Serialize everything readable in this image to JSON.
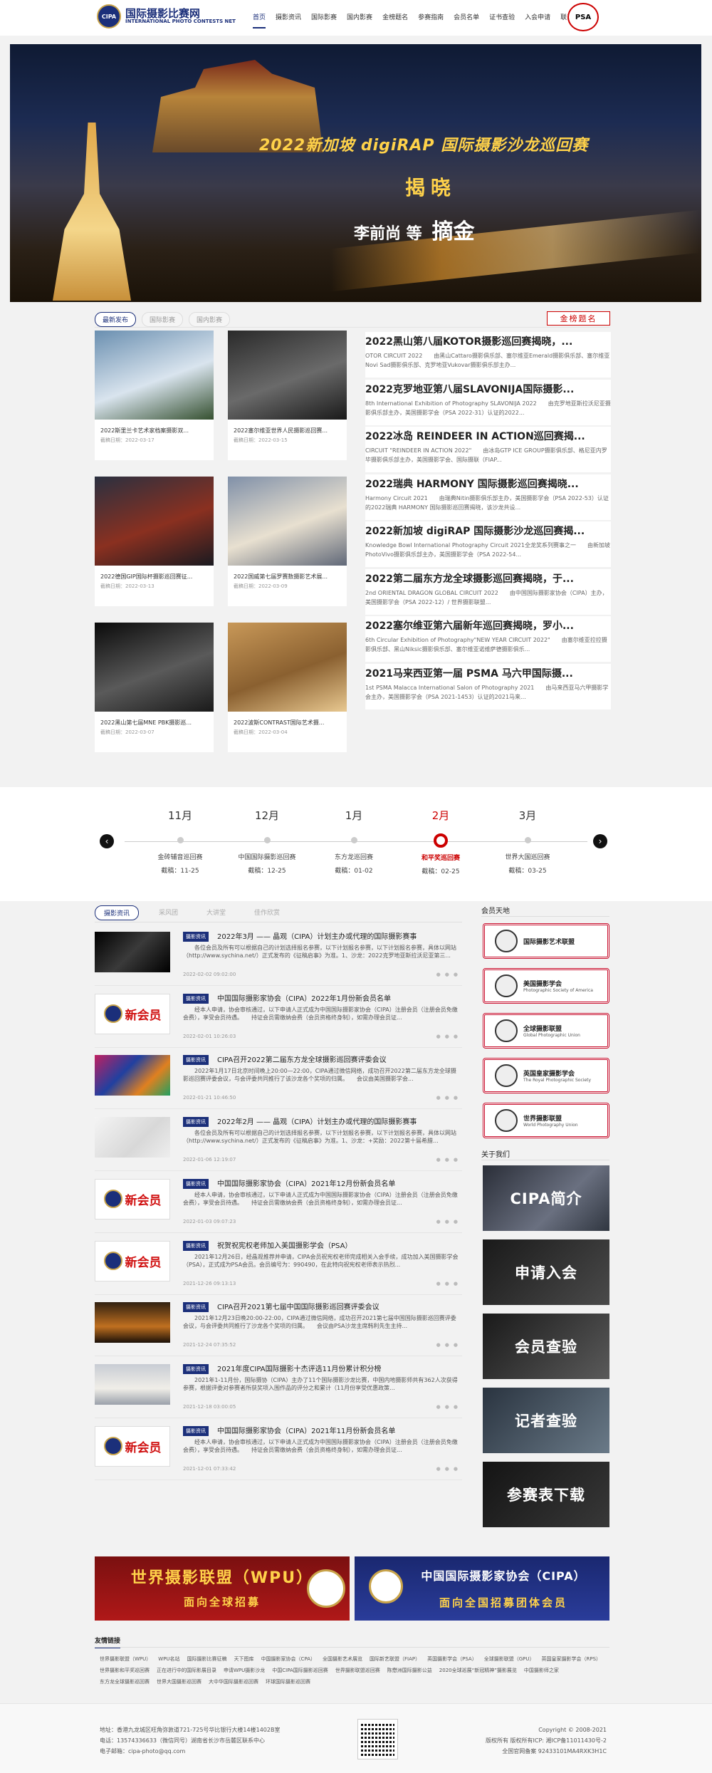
{
  "header": {
    "logo_cn": "国际摄影比赛网",
    "logo_en": "INTERNATIONAL PHOTO CONTESTS NET",
    "logo_badge": "CIPA",
    "nav": [
      "首页",
      "摄影资讯",
      "国际影赛",
      "国内影赛",
      "金榜题名",
      "参赛指南",
      "会员名单",
      "证书查验",
      "入会申请",
      "联系我们"
    ],
    "psa_badge": "PSA"
  },
  "banner": {
    "title": "2022新加坡 digiRAP 国际摄影沙龙巡回赛",
    "reveal": "揭晓",
    "name": "李前尚 等",
    "award": "摘金"
  },
  "news_tabs": [
    "最新发布",
    "国际影赛",
    "国内影赛"
  ],
  "gold_button": "金榜题名",
  "photo_cards": [
    {
      "title": "2022斯里兰卡艺术家档案摄影双...",
      "date": "截稿日期：2022-03-17",
      "palette": [
        "#6a8fb0",
        "#d9e4ee",
        "#355030"
      ]
    },
    {
      "title": "2022塞尔维亚世界人民摄影巡回赛...",
      "date": "截稿日期：2022-03-15",
      "palette": [
        "#2a2a2a",
        "#6a6a6a",
        "#1a1a1a"
      ]
    },
    {
      "title": "2022德国GIP国际杯摄影巡回赛征...",
      "date": "截稿日期：2022-03-13",
      "palette": [
        "#2a3040",
        "#8a3020",
        "#1a1a20"
      ]
    },
    {
      "title": "2022国威第七届罗赛数摄影艺术展...",
      "date": "截稿日期：2022-03-09",
      "palette": [
        "#8090a8",
        "#e8e0d0",
        "#606878"
      ]
    },
    {
      "title": "2022黑山第七届MNE PBK摄影巡...",
      "date": "截稿日期：2022-03-07",
      "palette": [
        "#0a0a0a",
        "#5a5a5a",
        "#1a1a1a"
      ]
    },
    {
      "title": "2022波斯CONTRAST国际艺术摄...",
      "date": "截稿日期：2022-03-04",
      "palette": [
        "#c89858",
        "#8a6030",
        "#e8c890"
      ]
    }
  ],
  "news_list": [
    {
      "title": "2022黑山第八届KOTOR摄影巡回赛揭晓，...",
      "desc": "OTOR CIRCUIT 2022　　由黑山Cattaro摄影俱乐部、塞尔维亚Emerald摄影俱乐部、塞尔维亚Novi Sad摄影俱乐部、克罗地亚Vukovar摄影俱乐部主办..."
    },
    {
      "title": "2022克罗地亚第八届SLAVONIJA国际摄影...",
      "desc": "8th International Exhibition of Photography SLAVONIJA 2022　　由克罗地亚斯拉沃尼亚摄影俱乐部主办，美国摄影学会（PSA 2022-31）认证的2022..."
    },
    {
      "title": "2022冰岛 REINDEER IN ACTION巡回赛揭...",
      "desc": "CIRCUIT \"REINDEER IN ACTION 2022\"　　由冰岛GTP ICE GROUP摄影俱乐部、格尼亚内罗毕摄影俱乐部主办，美国摄影学会、国际摄联（FIAP..."
    },
    {
      "title": "2022瑞典 HARMONY 国际摄影巡回赛揭晓...",
      "desc": "Harmony Circuit 2021　　由瑞典Nitin摄影俱乐部主办，美国摄影学会（PSA 2022-53）认证的2022瑞典 HARMONY 国际摄影巡回赛揭晓，该沙龙共设..."
    },
    {
      "title": "2022新加坡 digiRAP 国际摄影沙龙巡回赛揭...",
      "desc": "Knowledge Bowl International Photography Circuit 2021全龙奖系列赛事之一　　由新加坡PhotoVivo摄影俱乐部主办，美国摄影学会（PSA 2022-54..."
    },
    {
      "title": "2022第二届东方龙全球摄影巡回赛揭晓，于...",
      "desc": "2nd ORIENTAL DRAGON GLOBAL CIRCUIT 2022　　由中国国际摄影家协会（CIPA）主办，美国摄影学会（PSA 2022-12）/ 世界摄影联盟..."
    },
    {
      "title": "2022塞尔维亚第六届新年巡回赛揭晓，罗小...",
      "desc": "6th Circular Exhibition of Photography\"NEW YEAR CIRCUIT 2022\"　　由塞尔维亚拉拉摄影俱乐部、黑山Niksic摄影俱乐部、塞尔维亚诺维萨德摄影俱乐..."
    },
    {
      "title": "2021马来西亚第一届 PSMA 马六甲国际摄...",
      "desc": "1st PSMA Malacca International Salon of Photography 2021　　由马来西亚马六甲摄影学会主办，美国摄影学会（PSA 2021-1453）认证的2021马来..."
    }
  ],
  "timeline": {
    "items": [
      {
        "month": "11月",
        "name": "金砖辅音巡回赛",
        "date": "截稿：11-25"
      },
      {
        "month": "12月",
        "name": "中国国际摄影巡回赛",
        "date": "截稿：12-25"
      },
      {
        "month": "1月",
        "name": "东方龙巡回赛",
        "date": "截稿：01-02"
      },
      {
        "month": "2月",
        "name": "和平奖巡回赛",
        "date": "截稿：02-25"
      },
      {
        "month": "3月",
        "name": "世界大国巡回赛",
        "date": "截稿：03-25"
      }
    ]
  },
  "article_tabs": [
    "摄影资讯",
    "采风团",
    "大讲堂",
    "佳作欣赏"
  ],
  "articles": [
    {
      "tag": "摄影资讯",
      "title": "2022年3月 —— 晶观（CIPA）计划主办或代理的国际摄影赛事",
      "desc": "各位会员及所有可以根据自己的计划选择报名参赛，以下计划报名参赛，以下计划报名参赛，具体以网站（http://www.sychina.net/）正式发布的《征稿启事》为准。1、沙龙：2022克罗地亚斯拉沃尼亚第三...",
      "date": "2022-02-02 09:02:00",
      "thumb": "dark"
    },
    {
      "tag": "摄影资讯",
      "title": "中国国际摄影家协会（CIPA）2022年1月份新会员名单",
      "desc": "经本人申请，协会审核通过，以下申请人正式成为中国国际摄影家协会（CIPA）注册会员（注册会员免缴会费），享受会员待遇。　　持证会员需缴纳会费（会员资格终身制），如需办理会员证...",
      "date": "2022-02-01 10:26:03",
      "thumb": "member"
    },
    {
      "tag": "摄影资讯",
      "title": "CIPA召开2022第二届东方龙全球摄影巡回赛评委会议",
      "desc": "2022年1月17日北京时间晚上20:00—22:00，CIPA通过微信网络，成功召开2022第二届东方龙全球摄影巡回赛评委会议，与会评委共同推行了该沙龙各个奖项的归属。　　会议由美国摄影学会...",
      "date": "2022-01-21 10:46:50",
      "thumb": "color"
    },
    {
      "tag": "摄影资讯",
      "title": "2022年2月 —— 晶观（CIPA）计划主办或代理的国际摄影赛事",
      "desc": "各位会员及所有可以根据自己的计划选择报名参赛，以下计划报名参赛，以下计划报名参赛，具体以网站（http://www.sychina.net/）正式发布的《征稿启事》为准。1、沙龙：+奖励：2022第十届希腊...",
      "date": "2022-01-06 12:19:07",
      "thumb": "white"
    },
    {
      "tag": "摄影资讯",
      "title": "中国国际摄影家协会（CIPA）2021年12月份新会员名单",
      "desc": "经本人申请，协会审核通过，以下申请人正式成为中国国际摄影家协会（CIPA）注册会员（注册会员免缴会费），享受会员待遇。　　持证会员需缴纳会费（会员资格终身制），如需办理会员证...",
      "date": "2022-01-03 09:07:23",
      "thumb": "member"
    },
    {
      "tag": "摄影资讯",
      "title": "祝贺祝宪权老师加入美国摄影学会（PSA）",
      "desc": "2021年12月26日，经晶观推荐并申请，CIPA会员祝宪权老师完成相关入会手续，成功加入美国摄影学会（PSA），正式成为PSA会员。会员编号为：990490，在此特向祝宪权老师表示热烈...",
      "date": "2021-12-26 09:13:13",
      "thumb": "member"
    },
    {
      "tag": "摄影资讯",
      "title": "CIPA召开2021第七届中国国际摄影巡回赛评委会议",
      "desc": "2021年12月23日晚20:00-22:00，CIPA通过微信网络，成功召开2021第七届中国国际摄影巡回赛评委会议，与会评委共同推行了沙龙各个奖项的归属。　　会议由PSA沙龙主席韩利先生主持...",
      "date": "2021-12-24 07:35:52",
      "thumb": "orange"
    },
    {
      "tag": "摄影资讯",
      "title": "2021年度CIPA国际摄影十杰评选11月份累计积分榜",
      "desc": "2021年1-11月份，国际摄协（CIPA）主办了11个国际摄影沙龙比赛，中国内地摄影师共有362人次获得参赛，根据评委对参赛者所获奖项入围作品的评分之和累计（11月份享受优惠政策...",
      "date": "2021-12-18 03:00:05",
      "thumb": "mosque"
    },
    {
      "tag": "摄影资讯",
      "title": "中国国际摄影家协会（CIPA）2021年11月份新会员名单",
      "desc": "经本人申请，协会审核通过，以下申请人正式成为中国国际摄影家协会（CIPA）注册会员（注册会员免缴会费），享受会员待遇。　　持证会员需缴纳会费（会员资格终身制），如需办理会员证...",
      "date": "2021-12-01 07:33:42",
      "thumb": "member"
    }
  ],
  "new_member_label": "新会员",
  "sidebar": {
    "members_heading": "会员天地",
    "members": [
      {
        "cn": "国际摄影艺术联盟",
        "en": ""
      },
      {
        "cn": "美国摄影学会",
        "en": "Photographic Society of America"
      },
      {
        "cn": "全球摄影联盟",
        "en": "Global Photographic Union"
      },
      {
        "cn": "英国皇家摄影学会",
        "en": "The Royal Photographic Society"
      },
      {
        "cn": "世界摄影联盟",
        "en": "World Photography Union"
      }
    ],
    "about_heading": "关于我们",
    "about": [
      "CIPA简介",
      "申请入会",
      "会员查验",
      "记者查验",
      "参赛表下载"
    ]
  },
  "promos": [
    {
      "title": "世界摄影联盟（WPU）",
      "sub": "面向全球招募"
    },
    {
      "title": "中国国际摄影家协会（CIPA）",
      "sub": "面向全国招募团体会员"
    }
  ],
  "links": {
    "heading": "友情链接",
    "items": [
      "世界摄影联盟（WPU）",
      "WPU名站",
      "国际摄影比赛征稿",
      "天下图库",
      "中国摄影家协会（CPA）",
      "全国摄影艺术展览",
      "国际新艺联盟（FIAP）",
      "英国摄影学会（PSA）",
      "全球摄影联盟（GPU）",
      "英国皇家摄影学会（RPS）",
      "世界摄影和平奖巡回赛",
      "正在进行中的国际影展目录",
      "申请WPU摄影沙龙",
      "中国CIPA国际摄影巡回赛",
      "世界摄影联盟巡回赛",
      "陈懋洲国际摄影公益",
      "2020全球巡展“新冠精神”摄影展览",
      "中国摄影师之家",
      "东方龙全球摄影巡回赛",
      "世界大国摄影巡回赛",
      "大中华国际摄影巡回赛",
      "环球国际摄影巡回赛"
    ]
  },
  "footer": {
    "left": [
      "地址：香港九龙城区旺角弥敦道721-725号华比银行大楼14楼1402B室",
      "电话：13574336633（微信同号）湖南省长沙市岳麓区联系中心",
      "电子邮箱：cipa-photo@qq.com"
    ],
    "right": [
      "Copyright © 2008-2021",
      "版权所有 版权所有ICP: 湘ICP备11011430号-2",
      "全国官网备案 92433101MA4RXK3H1C"
    ]
  },
  "colors": {
    "brand": "#1b2f7a",
    "accent": "#c00000"
  }
}
